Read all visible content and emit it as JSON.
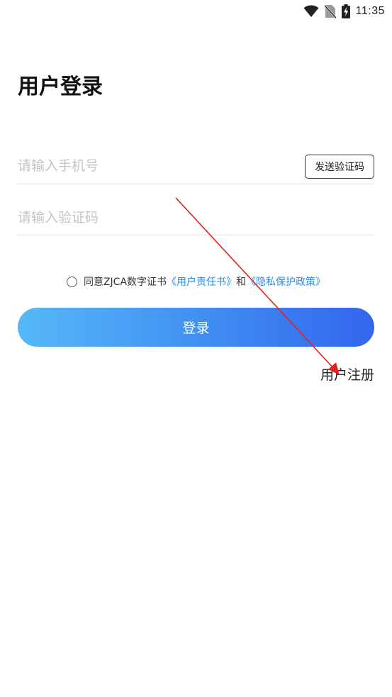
{
  "status_bar": {
    "time": "11:35",
    "icons": [
      "wifi-icon",
      "no-sim-icon",
      "battery-charging-icon"
    ]
  },
  "login": {
    "title": "用户登录",
    "phone_placeholder": "请输入手机号",
    "phone_value": "",
    "send_code_label": "发送验证码",
    "code_placeholder": "请输入验证码",
    "code_value": "",
    "agreement": {
      "checked": false,
      "prefix": "同意ZJCA数字证书",
      "link_terms": "《用户责任书》",
      "conjunction": "和",
      "link_privacy": "《隐私保护政策》"
    },
    "login_button": "登录",
    "register_link": "用户注册"
  },
  "colors": {
    "gradient_start": "#56b8f8",
    "gradient_end": "#3366ee",
    "link": "#2a8ae6",
    "annotation_arrow": "#e52222"
  }
}
